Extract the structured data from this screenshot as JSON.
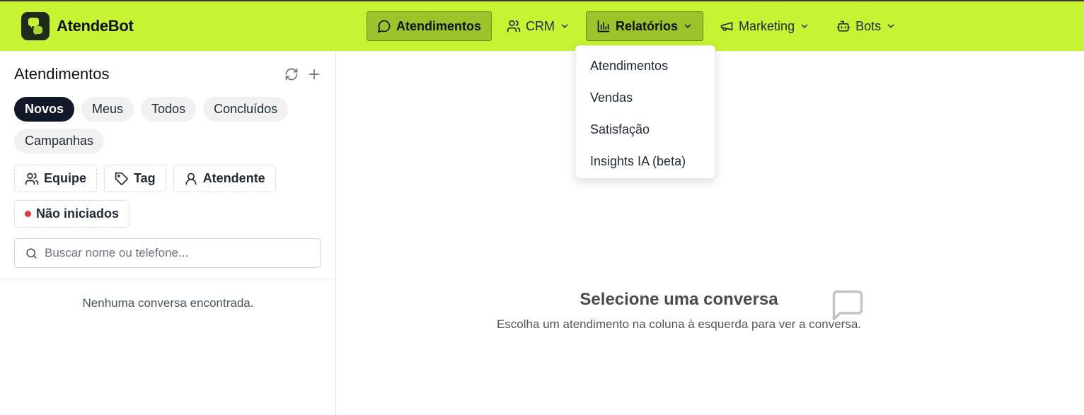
{
  "app": {
    "name": "AtendeBot"
  },
  "nav": [
    {
      "label": "Atendimentos",
      "icon": "chat-bubble-icon",
      "active": true,
      "has_caret": false
    },
    {
      "label": "CRM",
      "icon": "users-icon",
      "active": false,
      "has_caret": true
    },
    {
      "label": "Relatórios",
      "icon": "bar-chart-icon",
      "active": true,
      "has_caret": true
    },
    {
      "label": "Marketing",
      "icon": "megaphone-icon",
      "active": false,
      "has_caret": true
    },
    {
      "label": "Bots",
      "icon": "bot-icon",
      "active": false,
      "has_caret": true
    }
  ],
  "reports_menu": {
    "items": [
      "Atendimentos",
      "Vendas",
      "Satisfação",
      "Insights IA (beta)"
    ]
  },
  "sidebar": {
    "title": "Atendimentos",
    "tabs": [
      "Novos",
      "Meus",
      "Todos",
      "Concluídos",
      "Campanhas"
    ],
    "selected_tab": "Novos",
    "filters": [
      "Equipe",
      "Tag",
      "Atendente",
      "Não iniciados"
    ],
    "search_placeholder": "Buscar nome ou telefone...",
    "empty_text": "Nenhuma conversa encontrada."
  },
  "main": {
    "empty_title": "Selecione uma conversa",
    "empty_subtitle": "Escolha um atendimento na coluna à esquerda para ver a conversa."
  },
  "colors": {
    "accent": "#c6f432",
    "active_nav": "#9ac42a",
    "selected_chip": "#111827",
    "status_dot": "#e53935"
  }
}
